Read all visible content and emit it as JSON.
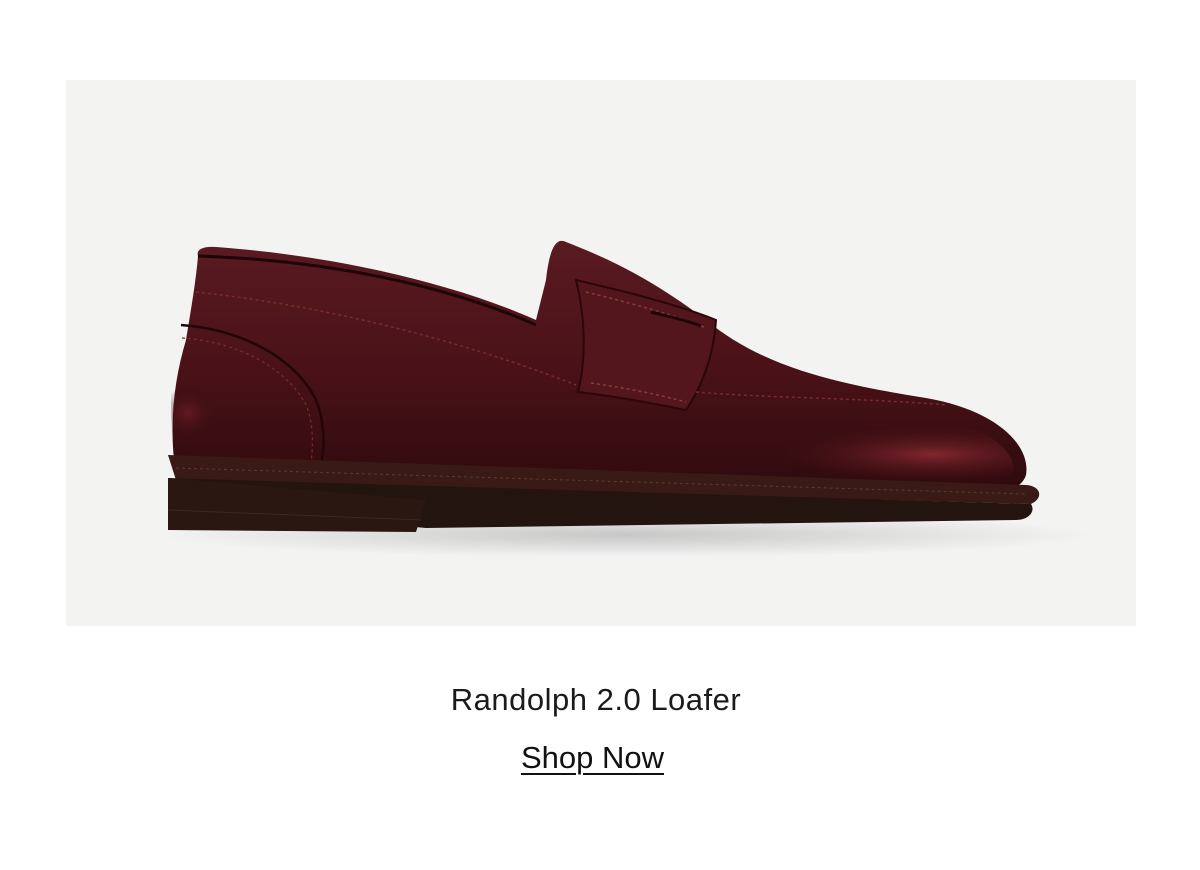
{
  "product": {
    "name": "Randolph 2.0 Loafer",
    "cta_label": "Shop Now",
    "image_background": "#f3f3f2",
    "leather_color": "#4a1418",
    "sole_color": "#2b1a16"
  }
}
